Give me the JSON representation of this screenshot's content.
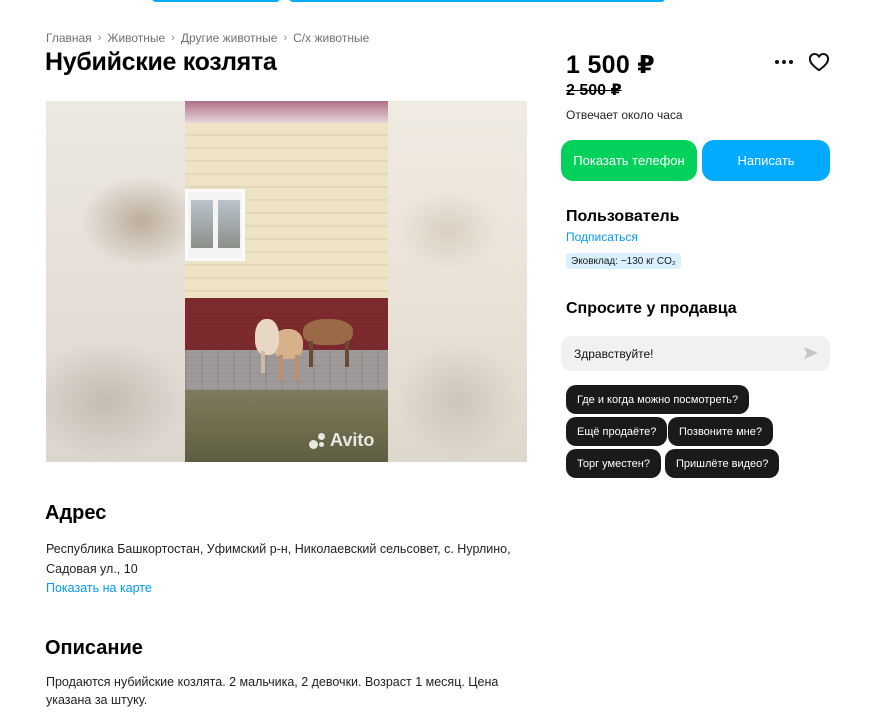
{
  "breadcrumb": {
    "items": [
      "Главная",
      "Животные",
      "Другие животные",
      "С/х животные"
    ],
    "separator": "›"
  },
  "listing": {
    "title": "Нубийские козлята",
    "price": "1 500 ₽",
    "old_price": "2 500 ₽",
    "response_time": "Отвечает около часа"
  },
  "gallery": {
    "watermark": "Avito"
  },
  "actions": {
    "show_phone_label": "Показать телефон",
    "write_label": "Написать",
    "more_icon": "more-dots-icon",
    "favorite_icon": "heart-icon"
  },
  "seller": {
    "name": "Пользователь",
    "subscribe_label": "Подписаться",
    "eco_badge": "Эковклад: −130 кг CO₂"
  },
  "ask": {
    "title": "Спросите у продавца",
    "input_value": "Здравствуйте!",
    "send_icon": "send-icon",
    "quick_questions": [
      "Где и когда можно посмотреть?",
      "Ещё продаёте?",
      "Позвоните мне?",
      "Торг уместен?",
      "Пришлёте видео?"
    ]
  },
  "address": {
    "title": "Адрес",
    "text": "Республика Башкортостан, Уфимский р-н, Николаевский сельсовет, с. Нурлино, Садовая ул., 10",
    "map_link": "Показать на карте"
  },
  "description": {
    "title": "Описание",
    "text": "Продаются нубийские козлята. 2 мальчика, 2 девочки. Возраст 1 месяц. Цена указана за штуку."
  },
  "colors": {
    "accent_blue": "#00aaff",
    "accent_green": "#02d15c",
    "link_blue": "#0099f7",
    "chip_dark": "#1a1a1a"
  }
}
